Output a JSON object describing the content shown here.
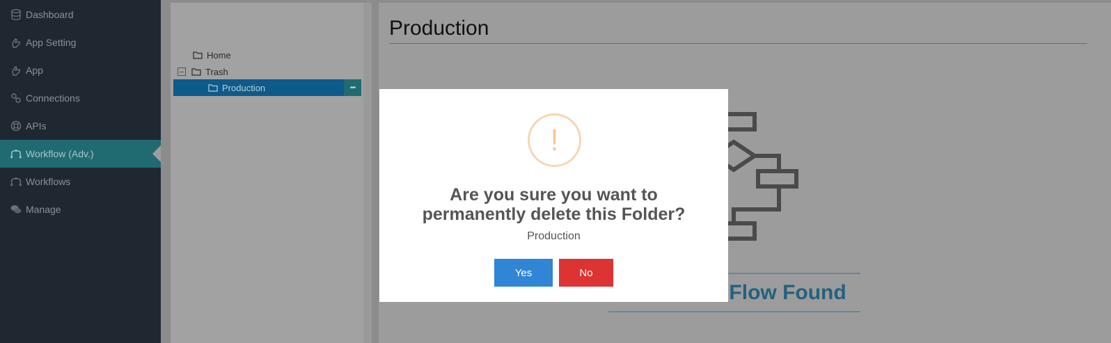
{
  "sidebar": {
    "items": [
      {
        "label": "Dashboard",
        "icon": "database-icon"
      },
      {
        "label": "App Setting",
        "icon": "hand-icon"
      },
      {
        "label": "App",
        "icon": "hand-icon"
      },
      {
        "label": "Connections",
        "icon": "link-icon"
      },
      {
        "label": "APIs",
        "icon": "lifebuoy-icon"
      },
      {
        "label": "Workflow (Adv.)",
        "icon": "workflow-icon",
        "active": true
      },
      {
        "label": "Workflows",
        "icon": "workflow-icon"
      },
      {
        "label": "Manage",
        "icon": "comments-icon"
      }
    ]
  },
  "tree": {
    "home": "Home",
    "trash": "Trash",
    "production": "Production",
    "more": "•••"
  },
  "content": {
    "title": "Production",
    "empty_text": "No Process Flow Found"
  },
  "modal": {
    "icon": "!",
    "title_line1": "Are you sure you want to",
    "title_line2": "permanently delete this Folder?",
    "subtitle": "Production",
    "yes_label": "Yes",
    "no_label": "No"
  },
  "colors": {
    "sidebar_bg": "#1f2830",
    "active_item": "#1f6b71",
    "selected_row": "#0e5a8a",
    "yes_button": "#3085d6",
    "no_button": "#dd3333",
    "warning": "#f8bb86"
  }
}
